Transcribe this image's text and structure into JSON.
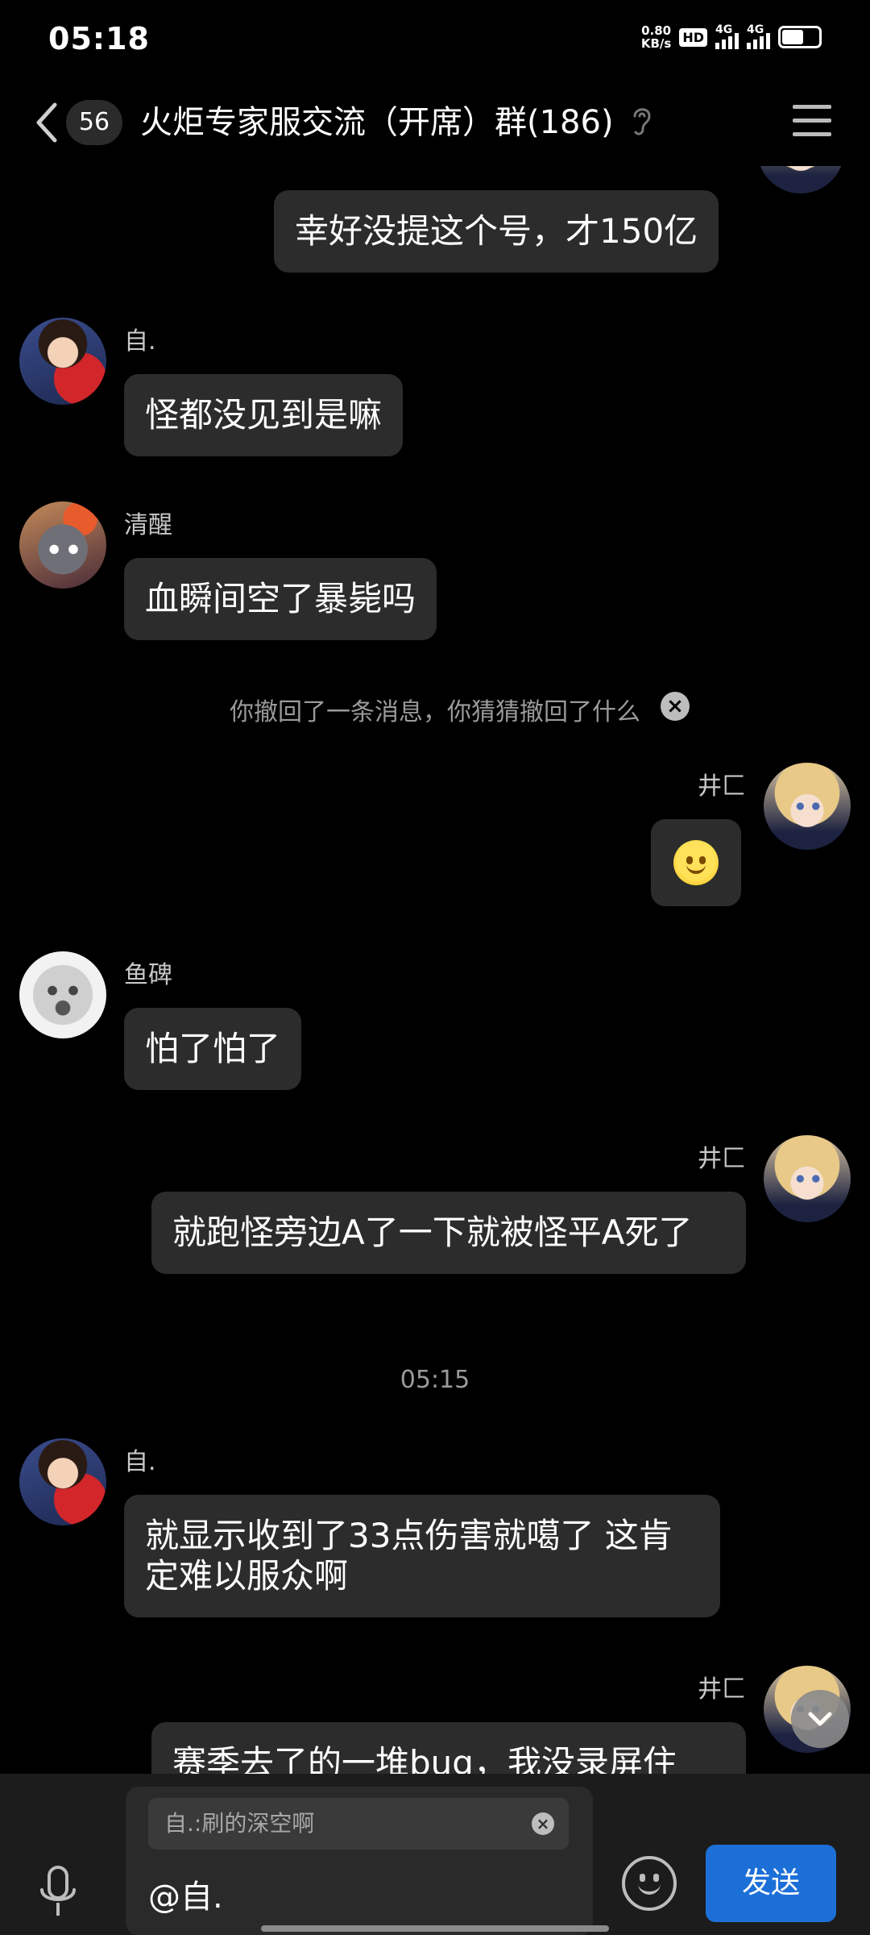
{
  "status_bar": {
    "time": "05:18",
    "net_speed": "0.80",
    "net_unit": "KB/s",
    "hd_label": "HD",
    "sim1_label": "4G",
    "sim2_label": "4G"
  },
  "header": {
    "unread_count": "56",
    "title": "火炬专家服交流（开席）群(186)"
  },
  "messages": [
    {
      "sender": "",
      "text": "幸好没提这个号，才150亿",
      "side": "right"
    },
    {
      "sender": "自.",
      "text": "怪都没见到是嘛",
      "side": "left"
    },
    {
      "sender": "清醒",
      "text": "血瞬间空了暴毙吗",
      "side": "left"
    },
    {
      "sender": "井匚",
      "text": "",
      "side": "right",
      "emoji": "smile"
    },
    {
      "sender": "鱼碑",
      "text": "怕了怕了",
      "side": "left"
    },
    {
      "sender": "井匚",
      "text": "就跑怪旁边A了一下就被怪平A死了",
      "side": "right"
    },
    {
      "sender": "自.",
      "text": "就显示收到了33点伤害就噶了 这肯定难以服众啊",
      "side": "left"
    },
    {
      "sender": "井匚",
      "text": "赛季去了的一堆bug，我没录屏住",
      "side": "right"
    }
  ],
  "notice": {
    "recall_text": "你撤回了一条消息，你猜猜撤回了什么",
    "close_glyph": "×"
  },
  "timestamp": "05:15",
  "input": {
    "reply_quote": "自.:刷的深空啊",
    "reply_close": "×",
    "text": "@自.",
    "send_label": "发送"
  }
}
